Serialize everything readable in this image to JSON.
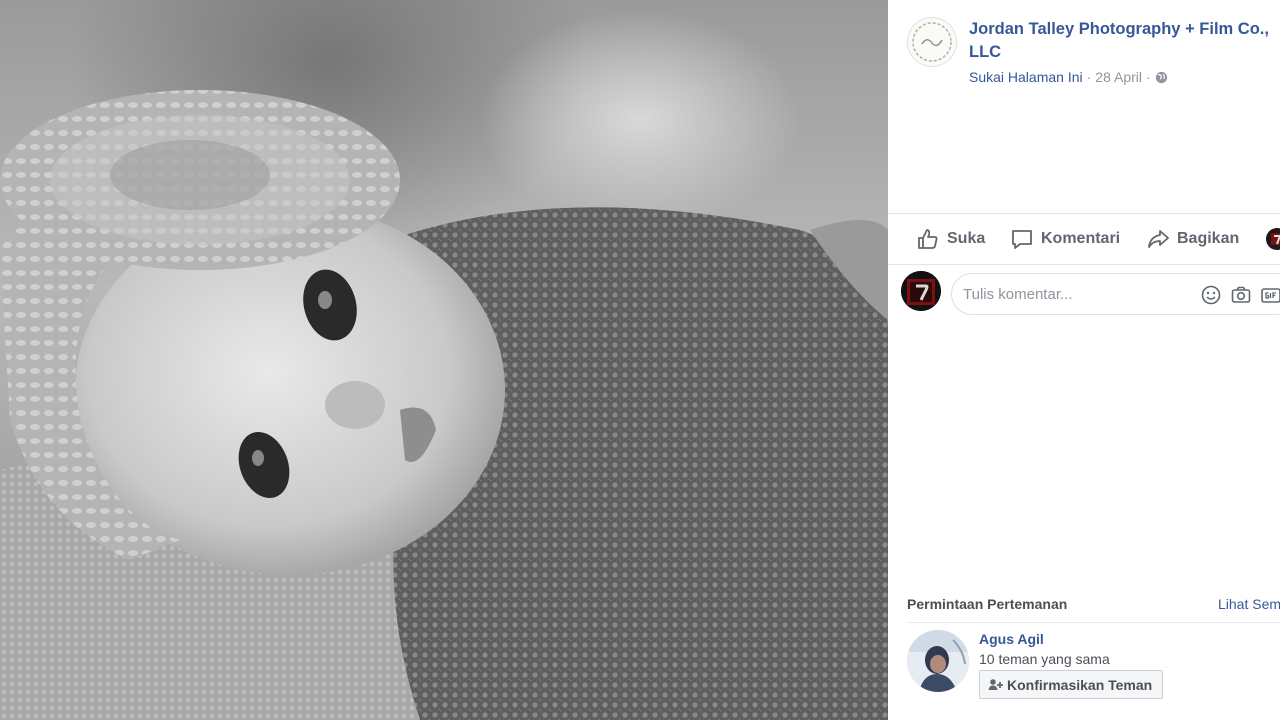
{
  "post": {
    "page_name": "Jordan Talley Photography + Film Co., LLC",
    "like_page_label": "Sukai Halaman Ini",
    "separator": "·",
    "date": "28 April",
    "privacy_icon": "globe-icon"
  },
  "actions": {
    "like_label": "Suka",
    "comment_label": "Komentari",
    "share_label": "Bagikan"
  },
  "comment_composer": {
    "placeholder": "Tulis komentar...",
    "icons": [
      "emoji-icon",
      "camera-icon",
      "gif-icon"
    ]
  },
  "friend_requests": {
    "title": "Permintaan Pertemanan",
    "see_all": "Lihat Sem",
    "items": [
      {
        "name": "Agus Agil",
        "mutual": "10 teman yang sama",
        "confirm_label": "Konfirmasikan Teman"
      }
    ]
  },
  "colors": {
    "link": "#365899",
    "secondary_text": "#90949c",
    "action_text": "#606770"
  }
}
